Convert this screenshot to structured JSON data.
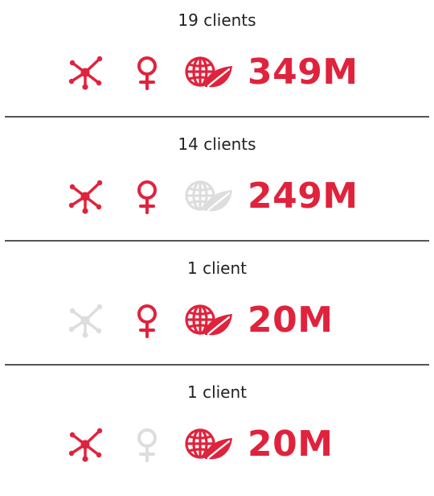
{
  "colors": {
    "active": "#e0233d",
    "inactive": "#dddddd",
    "text": "#222222",
    "divider": "#555555"
  },
  "groups": [
    {
      "clients_label": "19 clients",
      "amount": "349M",
      "icons": {
        "network": true,
        "female": true,
        "eco_globe": true
      }
    },
    {
      "clients_label": "14 clients",
      "amount": "249M",
      "icons": {
        "network": true,
        "female": true,
        "eco_globe": false
      }
    },
    {
      "clients_label": "1 client",
      "amount": "20M",
      "icons": {
        "network": false,
        "female": true,
        "eco_globe": true
      }
    },
    {
      "clients_label": "1 client",
      "amount": "20M",
      "icons": {
        "network": true,
        "female": false,
        "eco_globe": true
      }
    }
  ]
}
